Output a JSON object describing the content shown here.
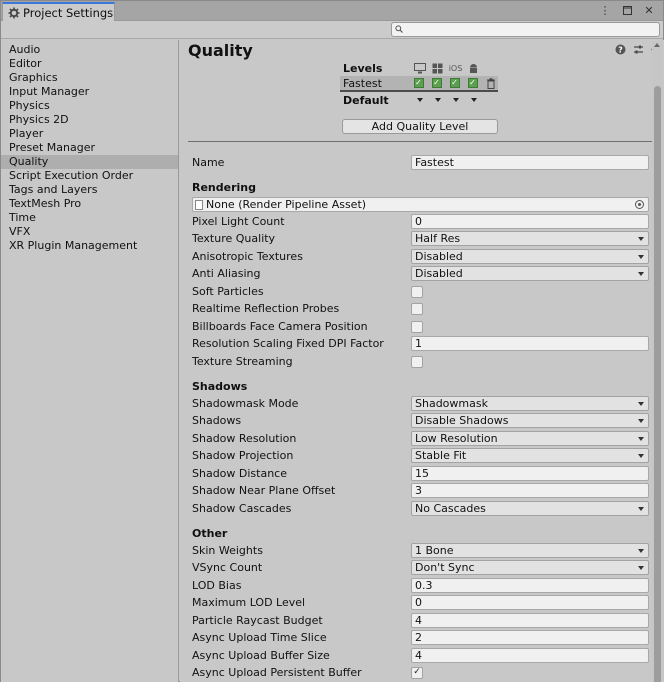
{
  "window": {
    "tab_label": "Project Settings",
    "tab_icon": "gear-icon"
  },
  "search": {
    "placeholder": "",
    "value": ""
  },
  "sidebar": {
    "items": [
      {
        "label": "Audio"
      },
      {
        "label": "Editor"
      },
      {
        "label": "Graphics"
      },
      {
        "label": "Input Manager"
      },
      {
        "label": "Physics"
      },
      {
        "label": "Physics 2D"
      },
      {
        "label": "Player"
      },
      {
        "label": "Preset Manager"
      },
      {
        "label": "Quality",
        "active": true
      },
      {
        "label": "Script Execution Order"
      },
      {
        "label": "Tags and Layers"
      },
      {
        "label": "TextMesh Pro"
      },
      {
        "label": "Time"
      },
      {
        "label": "VFX"
      },
      {
        "label": "XR Plugin Management"
      }
    ]
  },
  "main": {
    "title": "Quality",
    "levels": {
      "title": "Levels",
      "ios_label": "iOS",
      "rows": [
        {
          "name": "Fastest",
          "checks": 4
        },
        {
          "name": "Default"
        }
      ],
      "add_button": "Add Quality Level"
    },
    "name_label": "Name",
    "name_value": "Fastest",
    "rendering": {
      "section": "Rendering",
      "pipeline_asset": "None (Render Pipeline Asset)",
      "pixel_light_count": {
        "label": "Pixel Light Count",
        "value": "0"
      },
      "texture_quality": {
        "label": "Texture Quality",
        "value": "Half Res"
      },
      "anisotropic_textures": {
        "label": "Anisotropic Textures",
        "value": "Disabled"
      },
      "anti_aliasing": {
        "label": "Anti Aliasing",
        "value": "Disabled"
      },
      "soft_particles": {
        "label": "Soft Particles",
        "checked": false
      },
      "realtime_reflection_probes": {
        "label": "Realtime Reflection Probes",
        "checked": false
      },
      "billboards_face_camera": {
        "label": "Billboards Face Camera Position",
        "checked": false
      },
      "resolution_scaling": {
        "label": "Resolution Scaling Fixed DPI Factor",
        "value": "1"
      },
      "texture_streaming": {
        "label": "Texture Streaming",
        "checked": false
      }
    },
    "shadows": {
      "section": "Shadows",
      "shadowmask_mode": {
        "label": "Shadowmask Mode",
        "value": "Shadowmask"
      },
      "shadows": {
        "label": "Shadows",
        "value": "Disable Shadows"
      },
      "shadow_resolution": {
        "label": "Shadow Resolution",
        "value": "Low Resolution"
      },
      "shadow_projection": {
        "label": "Shadow Projection",
        "value": "Stable Fit"
      },
      "shadow_distance": {
        "label": "Shadow Distance",
        "value": "15"
      },
      "shadow_near_plane_offset": {
        "label": "Shadow Near Plane Offset",
        "value": "3"
      },
      "shadow_cascades": {
        "label": "Shadow Cascades",
        "value": "No Cascades"
      }
    },
    "other": {
      "section": "Other",
      "skin_weights": {
        "label": "Skin Weights",
        "value": "1 Bone"
      },
      "vsync_count": {
        "label": "VSync Count",
        "value": "Don't Sync"
      },
      "lod_bias": {
        "label": "LOD Bias",
        "value": "0.3"
      },
      "maximum_lod_level": {
        "label": "Maximum LOD Level",
        "value": "0"
      },
      "particle_raycast_budget": {
        "label": "Particle Raycast Budget",
        "value": "4"
      },
      "async_upload_time_slice": {
        "label": "Async Upload Time Slice",
        "value": "2"
      },
      "async_upload_buffer_size": {
        "label": "Async Upload Buffer Size",
        "value": "4"
      },
      "async_upload_persistent_buffer": {
        "label": "Async Upload Persistent Buffer",
        "checked": true
      }
    }
  }
}
